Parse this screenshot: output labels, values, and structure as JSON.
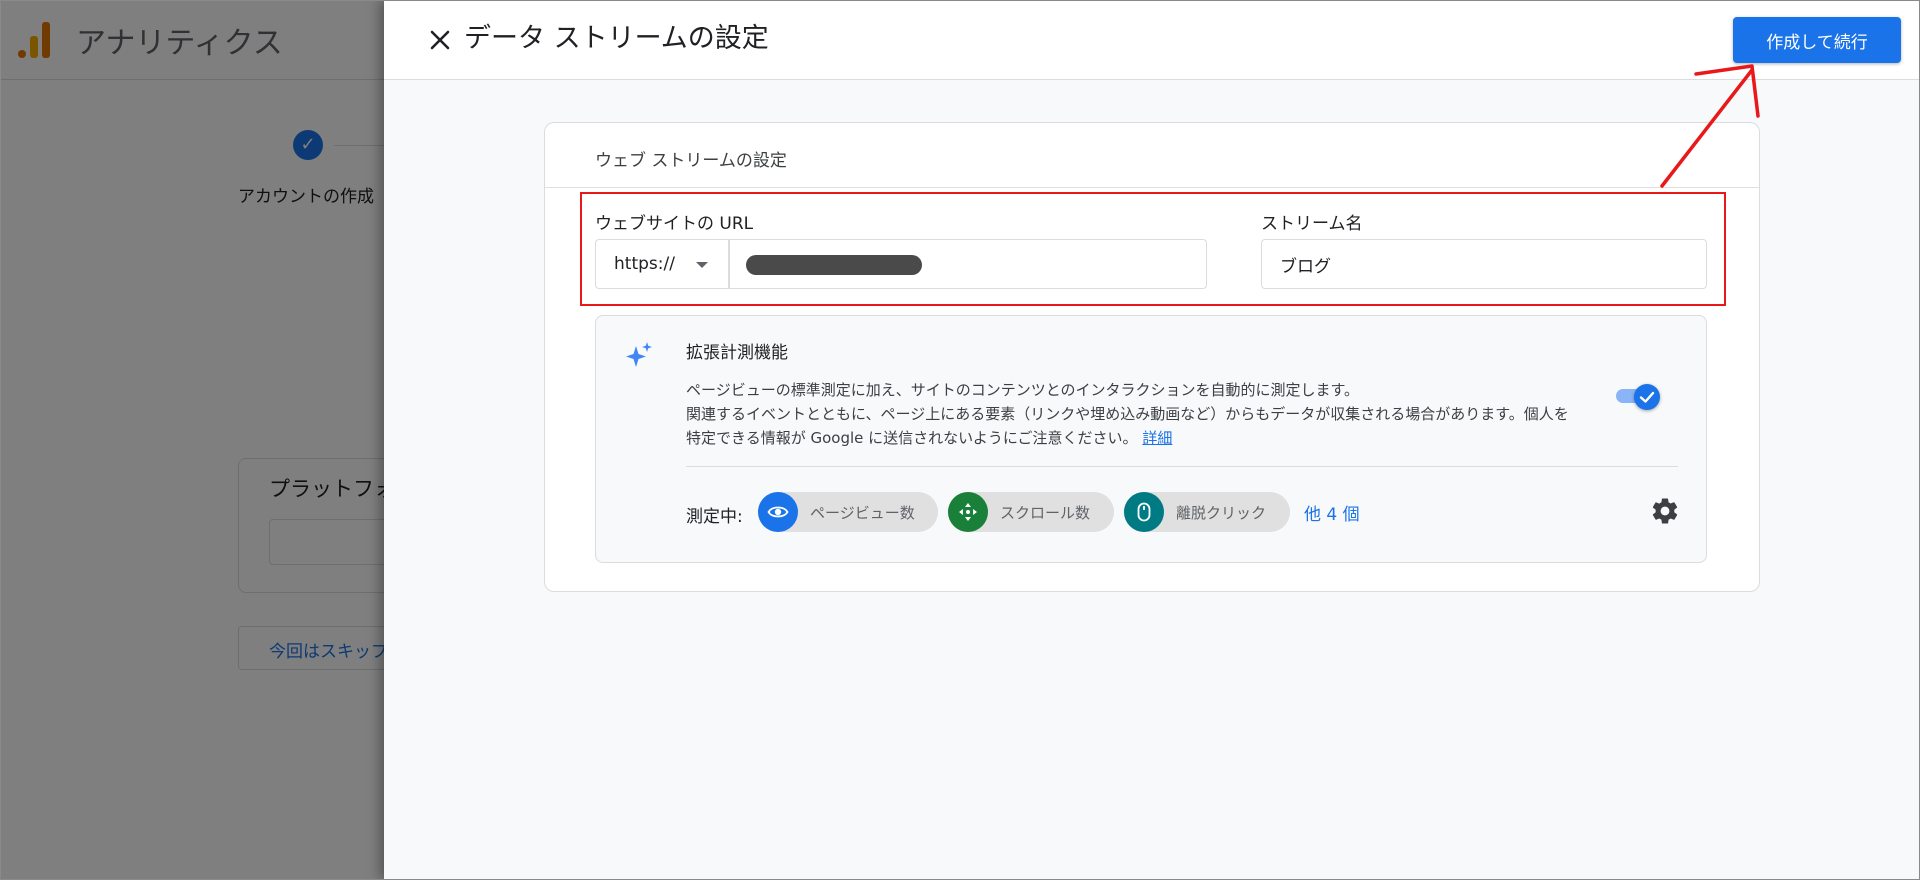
{
  "background_app": {
    "title": "アナリティクス",
    "step_label": "アカウントの作成",
    "card_title": "プラットフォ",
    "skip_label": "今回はスキップ"
  },
  "drawer": {
    "title": "データ ストリームの設定",
    "primary_button": "作成して続行",
    "section": {
      "title": "ウェブ ストリームの設定",
      "url_label": "ウェブサイトの URL",
      "scheme_value": "https://",
      "stream_name_label": "ストリーム名",
      "stream_name_value": "ブログ"
    },
    "enhanced": {
      "title": "拡張計測機能",
      "desc_line1": "ページビューの標準測定に加え、サイトのコンテンツとのインタラクションを自動的に測定します。",
      "desc_line2": "関連するイベントとともに、ページ上にある要素（リンクや埋め込み動画など）からもデータが収集される場合があります。個人を",
      "desc_line3": "特定できる情報が Google に送信されないようにご注意ください。",
      "details_link": "詳細",
      "toggle_on": true,
      "measuring_label": "測定中:",
      "chips": [
        {
          "label": "ページビュー数",
          "icon": "eye-icon",
          "color": "#1a73e8"
        },
        {
          "label": "スクロール数",
          "icon": "scroll-icon",
          "color": "#188038"
        },
        {
          "label": "離脱クリック",
          "icon": "mouse-icon",
          "color": "#007b83"
        }
      ],
      "more_link": "他 4 個"
    }
  },
  "colors": {
    "accent": "#1a73e8",
    "annotation_red": "#e8191a"
  }
}
